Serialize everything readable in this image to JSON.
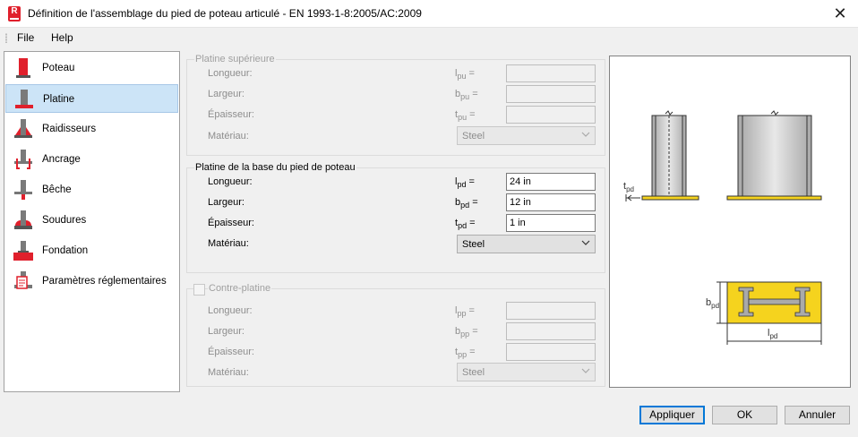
{
  "window": {
    "title": "Définition de l'assemblage du pied de poteau articulé - EN 1993-1-8:2005/AC:2009",
    "app_icon_letter": "R",
    "close_glyph": "✕"
  },
  "menu": {
    "file": "File",
    "help": "Help"
  },
  "sidebar": {
    "items": [
      {
        "label": "Poteau",
        "icon": "column-icon"
      },
      {
        "label": "Platine",
        "icon": "base-plate-icon",
        "selected": true
      },
      {
        "label": "Raidisseurs",
        "icon": "stiffeners-icon"
      },
      {
        "label": "Ancrage",
        "icon": "anchor-icon"
      },
      {
        "label": "Bêche",
        "icon": "shear-key-icon"
      },
      {
        "label": "Soudures",
        "icon": "welds-icon"
      },
      {
        "label": "Fondation",
        "icon": "foundation-icon"
      },
      {
        "label": "Paramètres réglementaires",
        "icon": "code-parameters-icon"
      }
    ]
  },
  "upper_plate": {
    "title": "Platine supérieure",
    "length_label": "Longueur:",
    "width_label": "Largeur:",
    "thickness_label": "Épaisseur:",
    "material_label": "Matériau:",
    "sym_l": "l",
    "sub_l": "pu",
    "sym_b": "b",
    "sub_b": "pu",
    "sym_t": "t",
    "sub_t": "pu",
    "eq": "=",
    "length_value": "",
    "width_value": "",
    "thickness_value": "",
    "material_value": "Steel"
  },
  "base_plate": {
    "title": "Platine de la base du pied de poteau",
    "length_label": "Longueur:",
    "width_label": "Largeur:",
    "thickness_label": "Épaisseur:",
    "material_label": "Matériau:",
    "sym_l": "l",
    "sub_l": "pd",
    "sym_b": "b",
    "sub_b": "pd",
    "sym_t": "t",
    "sub_t": "pd",
    "eq": "=",
    "length_value": "24 in",
    "width_value": "12 in",
    "thickness_value": "1 in",
    "material_value": "Steel"
  },
  "counter_plate": {
    "title": "Contre-platine",
    "checked": false,
    "length_label": "Longueur:",
    "width_label": "Largeur:",
    "thickness_label": "Épaisseur:",
    "material_label": "Matériau:",
    "sym_l": "l",
    "sub_l": "pp",
    "sym_b": "b",
    "sub_b": "pp",
    "sym_t": "t",
    "sub_t": "pp",
    "eq": "=",
    "length_value": "",
    "width_value": "",
    "thickness_value": "",
    "material_value": "Steel"
  },
  "preview": {
    "t_label": "t",
    "t_sub": "pd",
    "b_label": "b",
    "b_sub": "pd",
    "l_label": "l",
    "l_sub": "pd",
    "plate_color": "#f5d31e"
  },
  "buttons": {
    "apply": "Appliquer",
    "ok": "OK",
    "cancel": "Annuler"
  }
}
